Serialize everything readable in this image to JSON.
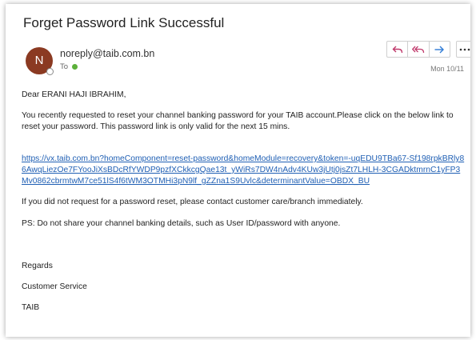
{
  "email": {
    "subject": "Forget Password Link Successful",
    "avatar_initial": "N",
    "sender": "noreply@taib.com.bn",
    "to_label": "To",
    "date": "Mon 10/11",
    "greeting": "Dear ERANI HAJI IBRAHIM,",
    "paragraph1": "You recently requested to reset your channel banking password for your TAIB account.Please click on the below link to reset your password. This password link is only valid for the next 15 mins.",
    "link_text": "https://vx.taib.com.bn?homeComponent=reset-password&homeModule=recovery&token=-uqEDU9TBa67-Sf198rpkBRly86AwqLiezOe7FYooJiXsBDcRfYWDP9pzfXCkkcgQae13t_yWiRs7DW4nAdv4KUw3jUtj0jsZt7LHLH-3CGADktmrnC1yFP3Mv0862cbrmtwM7ce51lS4f6tWM3OTMHi3pN9lf_gZZna1S9Uvlc&determinantValue=OBDX_BU",
    "paragraph2": "If you did not request for a password reset, please contact customer care/branch immediately.",
    "paragraph3": "PS: Do not share your channel banking details, such as User ID/password with anyone.",
    "regards": "Regards",
    "sign_team": "Customer Service",
    "sign_org": "TAIB"
  },
  "icons": {
    "reply": "reply-icon",
    "reply_all": "reply-all-icon",
    "forward": "forward-icon",
    "more": "more-icon"
  },
  "colors": {
    "avatar": "#8b3a22",
    "link": "#1f5fb4",
    "action_icon": "#c0396b",
    "forward_icon": "#2f7bd6",
    "presence": "#5cb03a"
  }
}
